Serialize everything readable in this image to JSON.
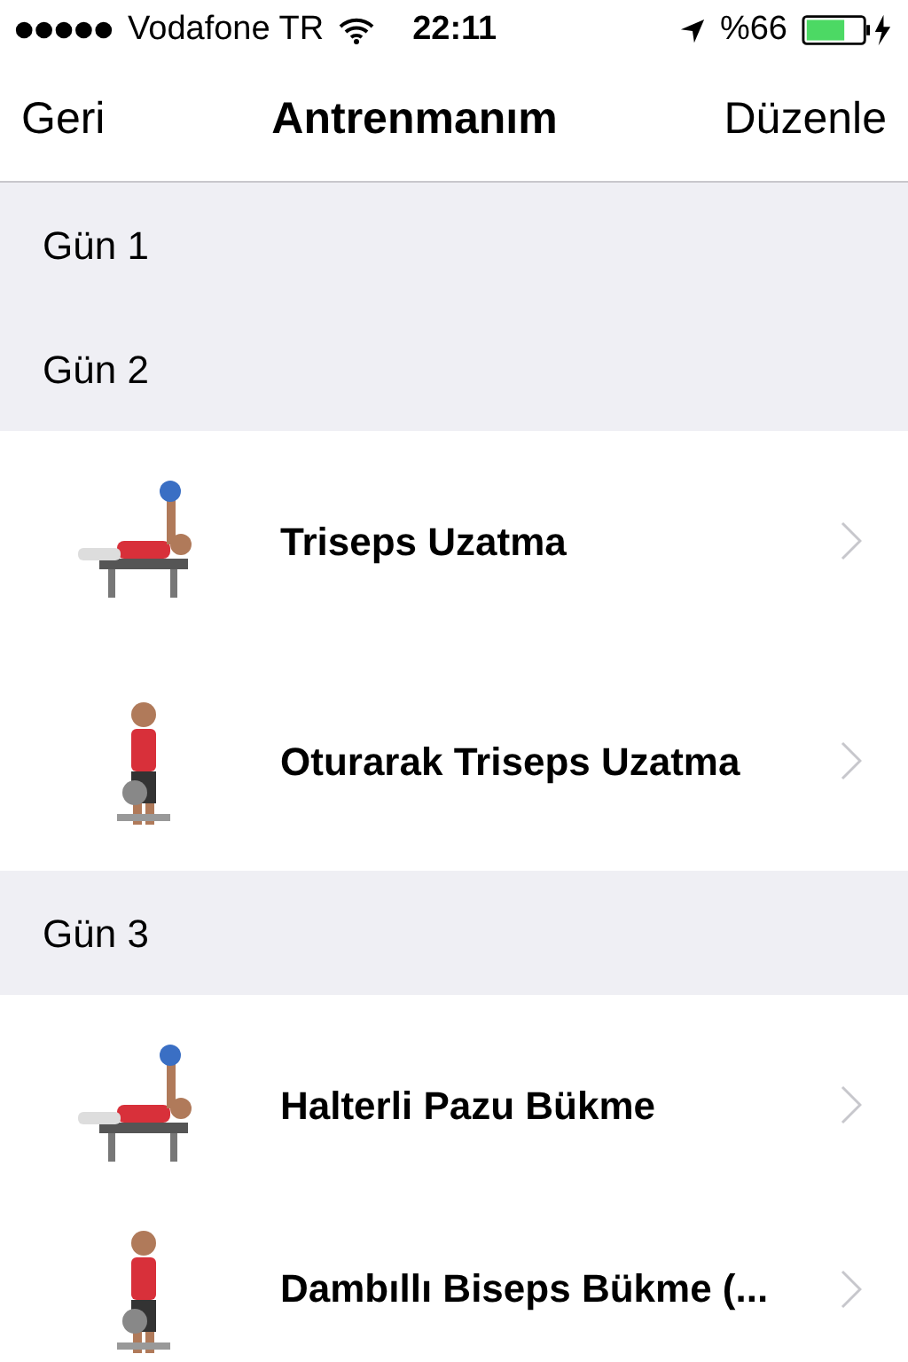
{
  "status_bar": {
    "carrier": "Vodafone TR",
    "time": "22:11",
    "battery": "%66"
  },
  "nav_bar": {
    "back": "Geri",
    "title": "Antrenmanım",
    "edit": "Düzenle"
  },
  "sections": [
    {
      "title": "Gün 1"
    },
    {
      "title": "Gün 2",
      "items": [
        {
          "title": "Triseps Uzatma"
        },
        {
          "title": "Oturarak Triseps Uzatma"
        }
      ]
    },
    {
      "title": "Gün 3",
      "items": [
        {
          "title": "Halterli Pazu Bükme"
        },
        {
          "title": "Dambıllı Biseps Bükme (..."
        }
      ]
    }
  ]
}
